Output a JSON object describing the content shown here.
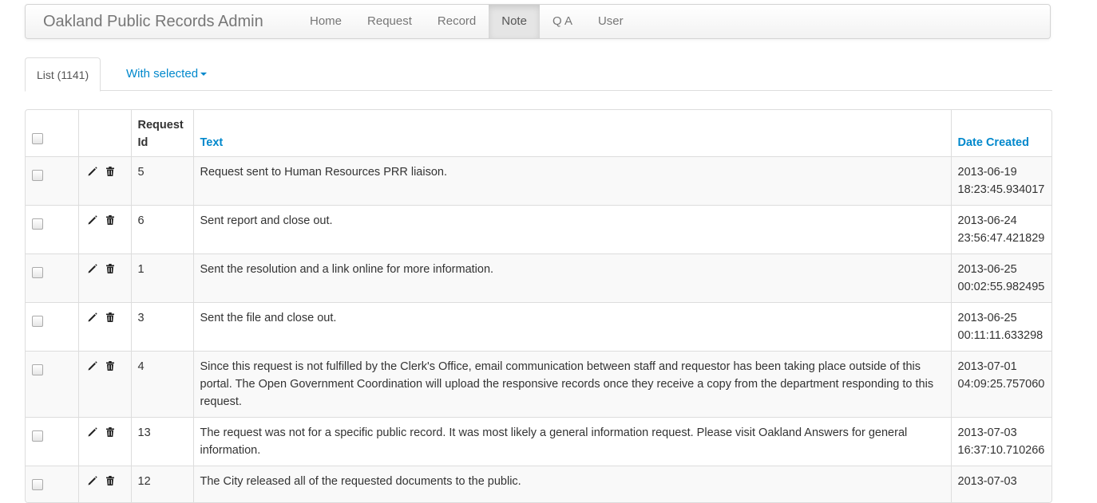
{
  "navbar": {
    "brand": "Oakland Public Records Admin",
    "items": [
      {
        "label": "Home",
        "active": false
      },
      {
        "label": "Request",
        "active": false
      },
      {
        "label": "Record",
        "active": false
      },
      {
        "label": "Note",
        "active": true
      },
      {
        "label": "Q A",
        "active": false
      },
      {
        "label": "User",
        "active": false
      }
    ]
  },
  "tabs": {
    "list_label": "List (1141)",
    "with_selected_label": "With selected"
  },
  "table": {
    "headers": {
      "request_id": "Request Id",
      "text": "Text",
      "date_created": "Date Created"
    },
    "row_icons": [
      "pencil-icon",
      "trash-icon"
    ],
    "rows": [
      {
        "request_id": "5",
        "text": "Request sent to Human Resources PRR liaison.",
        "date": "2013-06-19 18:23:45.934017"
      },
      {
        "request_id": "6",
        "text": "Sent report and close out.",
        "date": "2013-06-24 23:56:47.421829"
      },
      {
        "request_id": "1",
        "text": "Sent the resolution and a link online for more information.",
        "date": "2013-06-25 00:02:55.982495"
      },
      {
        "request_id": "3",
        "text": "Sent the file and close out.",
        "date": "2013-06-25 00:11:11.633298"
      },
      {
        "request_id": "4",
        "text": "Since this request is not fulfilled by the Clerk's Office, email communication between staff and requestor has been taking place outside of this portal. The Open Government Coordination will upload the responsive records once they receive a copy from the department responding to this request.",
        "date": "2013-07-01 04:09:25.757060"
      },
      {
        "request_id": "13",
        "text": "The request was not for a specific public record. It was most likely a general information request. Please visit Oakland Answers for general information.",
        "date": "2013-07-03 16:37:10.710266"
      },
      {
        "request_id": "12",
        "text": "The City released all of the requested documents to the public.",
        "date": "2013-07-03"
      }
    ]
  }
}
